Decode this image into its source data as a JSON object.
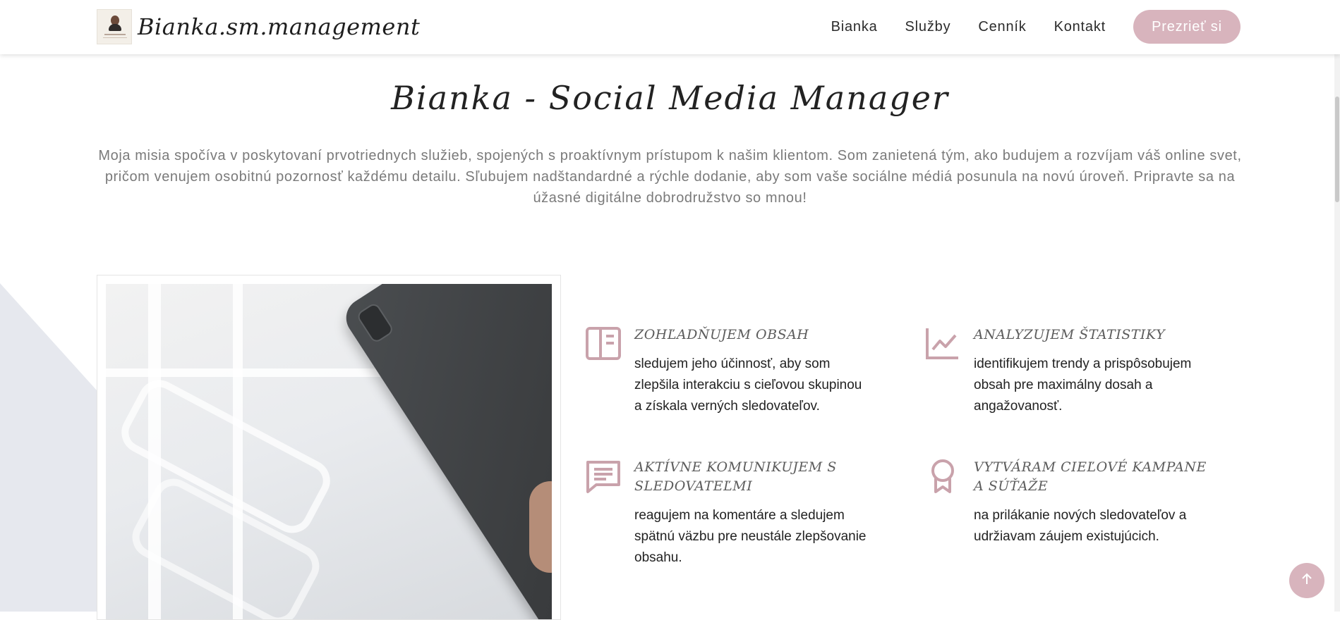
{
  "header": {
    "brand_name": "Bianka.sm.management",
    "nav": [
      "Bianka",
      "Služby",
      "Cenník",
      "Kontakt"
    ],
    "cta_label": "Prezrieť si"
  },
  "hero": {
    "title": "Bianka - Social Media Manager",
    "intro": "Moja misia spočíva v poskytovaní prvotriednych služieb, spojených s proaktívnym prístupom k našim klientom. Som zanietená tým, ako budujem a rozvíjam váš online svet, pričom venujem osobitnú pozornosť každému detailu. Sľubujem nadštandardné a rýchle dodanie, aby som vaše sociálne médiá posunula na novú úroveň. Pripravte sa na úžasné digitálne dobrodružstvo so mnou!"
  },
  "features": [
    {
      "icon": "layout-icon",
      "title": "ZOHĽADŇUJEM OBSAH",
      "text": "sledujem jeho účinnosť, aby som zlepšila interakciu s cieľovou skupinou a získala verných sledovateľov."
    },
    {
      "icon": "chart-line-icon",
      "title": "ANALYZUJEM ŠTATISTIKY",
      "text": "identifikujem trendy a prispôsobujem obsah pre maximálny dosah a angažovanosť."
    },
    {
      "icon": "chat-icon",
      "title": "AKTÍVNE KOMUNIKUJEM S SLEDOVATEĽMI",
      "text": "reagujem na komentáre a sledujem spätnú väzbu pre neustále zlepšovanie obsahu."
    },
    {
      "icon": "award-icon",
      "title": "VYTVÁRAM CIEĽOVÉ KAMPANE A SÚŤAŽE",
      "text": "na prilákanie nových sledovateľov a udržiavam záujem existujúcich."
    }
  ],
  "colors": {
    "accent": "#d8b4bd",
    "icon": "#c9a2ab",
    "text": "#222222",
    "muted": "#7a7a7a"
  }
}
